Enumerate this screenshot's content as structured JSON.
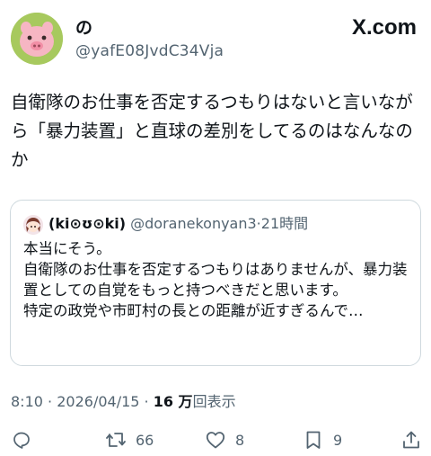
{
  "brand": {
    "label": "X.com"
  },
  "author": {
    "display_name": "の",
    "handle": "@yafE08JvdC34Vja",
    "avatar_icon": "pig-face-icon"
  },
  "tweet": {
    "text": "自衛隊のお仕事を否定するつもりはないと言いながら「暴力装置」と直球の差別をしてるのはなんなのか"
  },
  "quote": {
    "display_name": "(ki⊙ʊ⊙ki)",
    "handle": "@doranekonyan3",
    "separator": "·",
    "time": "21時間",
    "avatar_icon": "anime-girl-avatar-icon",
    "lines": [
      "本当にそう。",
      "自衛隊のお仕事を否定するつもりはありませんが、暴力装置としての自覚をもっと持つべきだと思います。",
      "特定の政党や市町村の長との距離が近すぎるんで…"
    ]
  },
  "meta": {
    "time": "8:10",
    "separator": "·",
    "date": "2026/04/15",
    "separator2": "·",
    "views": "16 万",
    "views_label": "回表示"
  },
  "actions": {
    "reply_icon": "reply-icon",
    "retweet_icon": "retweet-icon",
    "retweet_count": "66",
    "like_icon": "heart-icon",
    "like_count": "8",
    "bookmark_icon": "bookmark-icon",
    "bookmark_count": "9",
    "share_icon": "share-icon"
  },
  "colors": {
    "text": "#0f1419",
    "secondary": "#536471",
    "border": "#cfd9de",
    "avatar_bg": "#a7c95e",
    "pig": "#f6b6c3"
  }
}
